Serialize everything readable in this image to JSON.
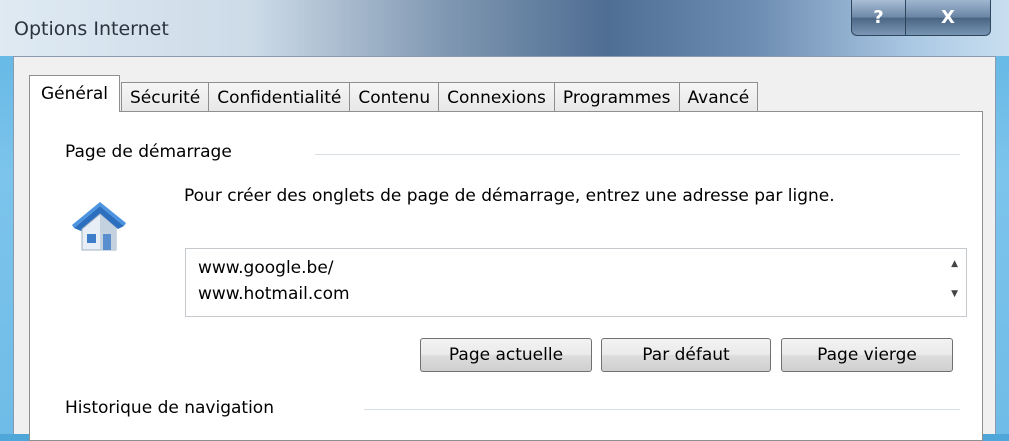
{
  "window": {
    "title": "Options Internet",
    "help_label": "?",
    "close_label": "X"
  },
  "tabs": [
    {
      "label": "Général",
      "active": true
    },
    {
      "label": "Sécurité"
    },
    {
      "label": "Confidentialité"
    },
    {
      "label": "Contenu"
    },
    {
      "label": "Connexions"
    },
    {
      "label": "Programmes"
    },
    {
      "label": "Avancé"
    }
  ],
  "startup": {
    "group_label": "Page de démarrage",
    "icon": "home-icon",
    "description": "Pour créer des onglets de page de démarrage, entrez une adresse par ligne.",
    "urls": "www.google.be/\nwww.hotmail.com",
    "buttons": {
      "current": "Page actuelle",
      "default": "Par défaut",
      "blank": "Page vierge"
    }
  },
  "history": {
    "group_label": "Historique de navigation"
  },
  "colors": {
    "tab_border": "#8e8f8f",
    "group_line": "#d5dfe5",
    "title_gradient_dark": "#4f6e93"
  }
}
